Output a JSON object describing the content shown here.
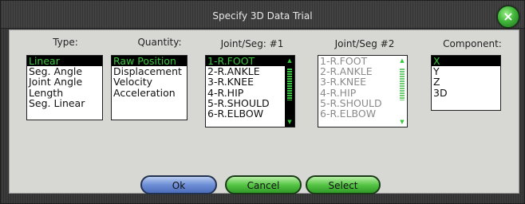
{
  "window": {
    "title": "Specify 3D Data Trial",
    "close_label": "×"
  },
  "columns": {
    "type": {
      "label": "Type:",
      "items": [
        "Linear",
        "Seg. Angle",
        "Joint Angle",
        "Length",
        "Seg. Linear"
      ],
      "selected": "Linear"
    },
    "quantity": {
      "label": "Quantity:",
      "items": [
        "Raw Position",
        "Displacement",
        "Velocity",
        "Acceleration"
      ],
      "selected": "Raw Position"
    },
    "joint1": {
      "label": "Joint/Seg: #1",
      "items": [
        "1-R.FOOT",
        "2-R.ANKLE",
        "3-R.KNEE",
        "4-R.HIP",
        "5-R.SHOULD",
        "6-R.ELBOW"
      ],
      "selected": "1-R.FOOT"
    },
    "joint2": {
      "label": "Joint/Seg #2",
      "items": [
        "1-R.FOOT",
        "2-R.ANKLE",
        "3-R.KNEE",
        "4-R.HIP",
        "5-R.SHOULD",
        "6-R.ELBOW"
      ],
      "disabled": true
    },
    "component": {
      "label": "Component:",
      "items": [
        "X",
        "Y",
        "Z",
        "3D"
      ],
      "selected": "X"
    }
  },
  "buttons": {
    "ok": "Ok",
    "cancel": "Cancel",
    "select": "Select"
  },
  "colors": {
    "selection_text": "#39c53f",
    "selection_bg": "#000000",
    "ok_button": "#6d8fd6",
    "green_button": "#56c545"
  }
}
